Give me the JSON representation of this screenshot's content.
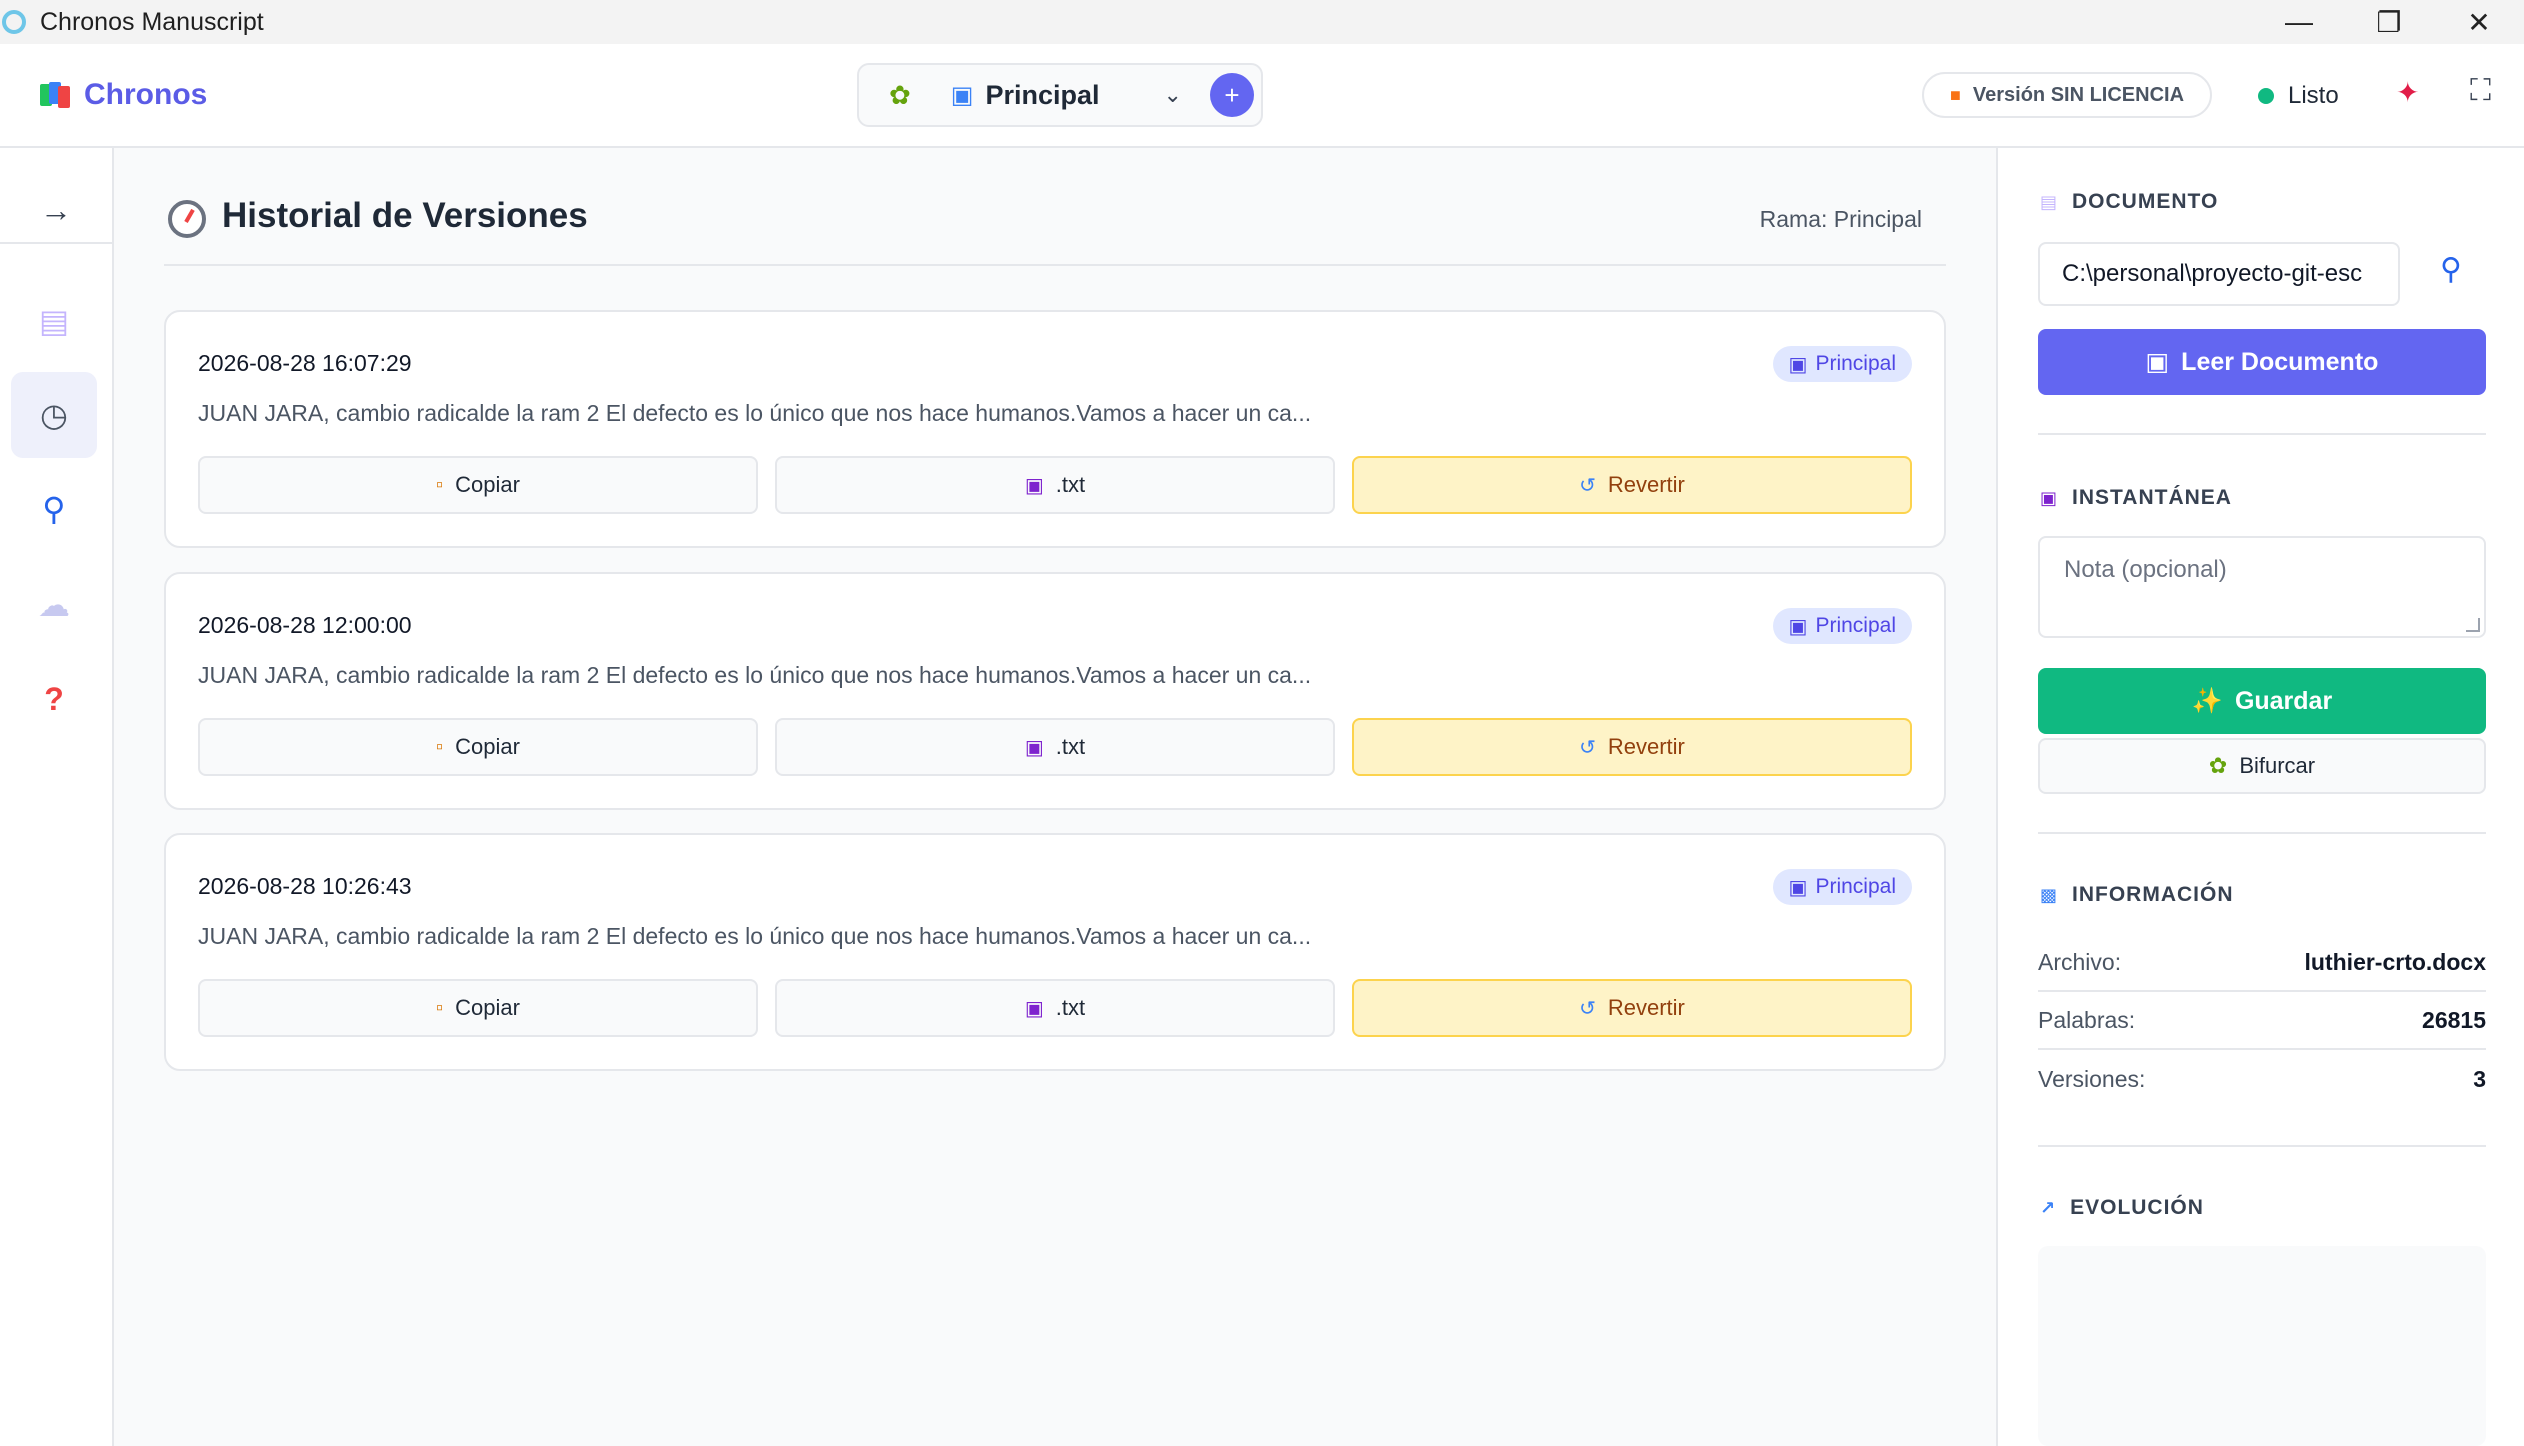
{
  "window": {
    "title": "Chronos Manuscript"
  },
  "header": {
    "brand": "Chronos",
    "branch": "Principal",
    "license": "Versión SIN LICENCIA",
    "status": "Listo"
  },
  "main": {
    "title": "Historial de Versiones",
    "branch_label": "Rama: Principal",
    "versions": [
      {
        "timestamp": "2026-08-28 16:07:29",
        "branch": "Principal",
        "message": "JUAN JARA, cambio radicalde la ram 2 El defecto es lo único que nos hace humanos.Vamos a hacer un ca...",
        "copy_label": "Copiar",
        "txt_label": ".txt",
        "revert_label": "Revertir"
      },
      {
        "timestamp": "2026-08-28 12:00:00",
        "branch": "Principal",
        "message": "JUAN JARA, cambio radicalde la ram 2 El defecto es lo único que nos hace humanos.Vamos a hacer un ca...",
        "copy_label": "Copiar",
        "txt_label": ".txt",
        "revert_label": "Revertir"
      },
      {
        "timestamp": "2026-08-28 10:26:43",
        "branch": "Principal",
        "message": "JUAN JARA, cambio radicalde la ram 2 El defecto es lo único que nos hace humanos.Vamos a hacer un ca...",
        "copy_label": "Copiar",
        "txt_label": ".txt",
        "revert_label": "Revertir"
      }
    ]
  },
  "sidebar": {
    "document": {
      "title": "DOCUMENTO",
      "path": "C:\\personal\\proyecto-git-esc",
      "read_label": "Leer Documento"
    },
    "snapshot": {
      "title": "INSTANTÁNEA",
      "note_placeholder": "Nota (opcional)",
      "save_label": "Guardar",
      "fork_label": "Bifurcar"
    },
    "info": {
      "title": "INFORMACIÓN",
      "file_label": "Archivo:",
      "file_value": "luthier-crto.docx",
      "words_label": "Palabras:",
      "words_value": "26815",
      "versions_label": "Versiones:",
      "versions_value": "3"
    },
    "evolution": {
      "title": "EVOLUCIÓN"
    }
  },
  "colors": {
    "brand": "#5b5ce6",
    "primary": "#6366f1",
    "success": "#10b981",
    "revert_bg": "#fef3c7"
  },
  "icons": {
    "rail": [
      "arrow-right-icon",
      "document-icon",
      "clock-icon",
      "search-icon",
      "cloud-icon",
      "help-icon"
    ]
  }
}
